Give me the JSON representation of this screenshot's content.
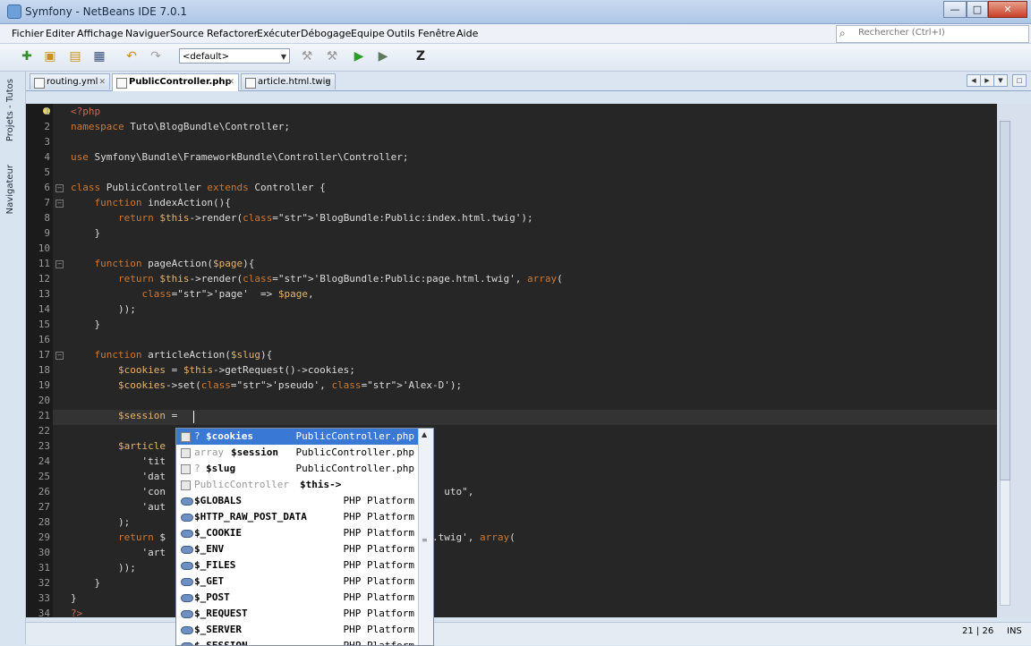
{
  "window": {
    "title": "Symfony - NetBeans IDE 7.0.1",
    "minimize": "—",
    "maximize": "□",
    "close": "✕"
  },
  "menu": [
    "Fichier",
    "Editer",
    "Affichage",
    "Naviguer",
    "Source",
    "Refactorer",
    "Exécuter",
    "Débogage",
    "Equipe",
    "Outils",
    "Fenêtre",
    "Aide"
  ],
  "search": {
    "placeholder": "Rechercher (Ctrl+I)",
    "icon": "search-icon"
  },
  "toolbar": {
    "config_select": "<default>"
  },
  "left_panels": {
    "projects": "Projets - Tutos",
    "navigator": "Navigateur"
  },
  "tabs": [
    {
      "label": "routing.yml",
      "active": false
    },
    {
      "label": "PublicController.php",
      "active": true
    },
    {
      "label": "article.html.twig",
      "active": false
    }
  ],
  "editor": {
    "line_numbers": [
      "1",
      "2",
      "3",
      "4",
      "5",
      "6",
      "7",
      "8",
      "9",
      "10",
      "11",
      "12",
      "13",
      "14",
      "15",
      "16",
      "17",
      "18",
      "19",
      "20",
      "21",
      "22",
      "23",
      "24",
      "25",
      "26",
      "27",
      "28",
      "29",
      "30",
      "31",
      "32",
      "33",
      "34"
    ],
    "lines": [
      "<?php",
      "namespace Tuto\\BlogBundle\\Controller;",
      "",
      "use Symfony\\Bundle\\FrameworkBundle\\Controller\\Controller;",
      "",
      "class PublicController extends Controller {",
      "    function indexAction(){",
      "        return $this->render('BlogBundle:Public:index.html.twig');",
      "    }",
      "",
      "    function pageAction($page){",
      "        return $this->render('BlogBundle:Public:page.html.twig', array(",
      "            'page'  => $page,",
      "        ));",
      "    }",
      "",
      "    function articleAction($slug){",
      "        $cookies = $this->getRequest()->cookies;",
      "        $cookies->set('pseudo', 'Alex-D');",
      "",
      "        $session = ",
      "",
      "        $article",
      "            'tit",
      "            'dat",
      "            'con                                               uto\",",
      "            'aut",
      "        );",
      "        return $                                         html.twig', array(",
      "            'art",
      "        ));",
      "    }",
      "}",
      "?>"
    ]
  },
  "completion": {
    "items": [
      {
        "type": "?",
        "name": "$cookies",
        "source": "PublicController.php",
        "selected": true
      },
      {
        "type": "array",
        "name": "$session",
        "source": "PublicController.php",
        "selected": false
      },
      {
        "type": "?",
        "name": "$slug",
        "source": "PublicController.php",
        "selected": false
      },
      {
        "type": "PublicController",
        "name": "$this->",
        "source": "",
        "selected": false
      },
      {
        "type": "",
        "name": "$GLOBALS",
        "source": "PHP Platform",
        "selected": false
      },
      {
        "type": "",
        "name": "$HTTP_RAW_POST_DATA",
        "source": "PHP Platform",
        "selected": false
      },
      {
        "type": "",
        "name": "$_COOKIE",
        "source": "PHP Platform",
        "selected": false
      },
      {
        "type": "",
        "name": "$_ENV",
        "source": "PHP Platform",
        "selected": false
      },
      {
        "type": "",
        "name": "$_FILES",
        "source": "PHP Platform",
        "selected": false
      },
      {
        "type": "",
        "name": "$_GET",
        "source": "PHP Platform",
        "selected": false
      },
      {
        "type": "",
        "name": "$_POST",
        "source": "PHP Platform",
        "selected": false
      },
      {
        "type": "",
        "name": "$_REQUEST",
        "source": "PHP Platform",
        "selected": false
      },
      {
        "type": "",
        "name": "$_SERVER",
        "source": "PHP Platform",
        "selected": false
      },
      {
        "type": "",
        "name": "$_SESSION",
        "source": "PHP Platform",
        "selected": false
      }
    ]
  },
  "status": {
    "position": "21 | 26",
    "mode": "INS"
  },
  "colors": {
    "editor_bg": "#262626",
    "keyword": "#cc7832",
    "string": "#c4a56a",
    "selection": "#3a78d6"
  }
}
